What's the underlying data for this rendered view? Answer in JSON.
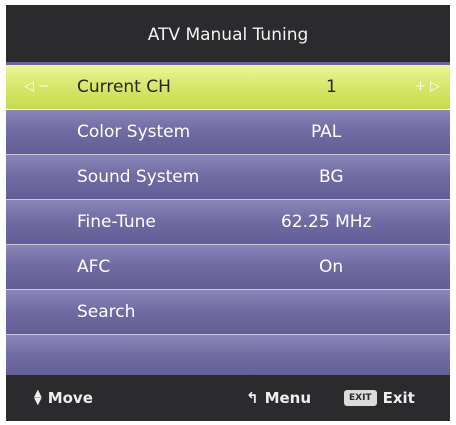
{
  "title": "ATV Manual Tuning",
  "menu": [
    {
      "label": "Current CH",
      "value": "1"
    },
    {
      "label": "Color System",
      "value": "PAL"
    },
    {
      "label": "Sound System",
      "value": "BG"
    },
    {
      "label": "Fine-Tune",
      "value": "62.25 MHz"
    },
    {
      "label": "AFC",
      "value": "On"
    },
    {
      "label": "Search",
      "value": ""
    }
  ],
  "footer": {
    "move_label": "Move",
    "menu_label": "Menu",
    "exit_key": "EXIT",
    "exit_label": "Exit"
  },
  "icons": {
    "left": "arrow-left-icon",
    "right": "arrow-right-icon",
    "updown": "up-down-icon",
    "return": "return-icon"
  },
  "colors": {
    "highlight": "#d8e86e",
    "panel": "#6b669c",
    "bar": "#2b2b2e"
  }
}
